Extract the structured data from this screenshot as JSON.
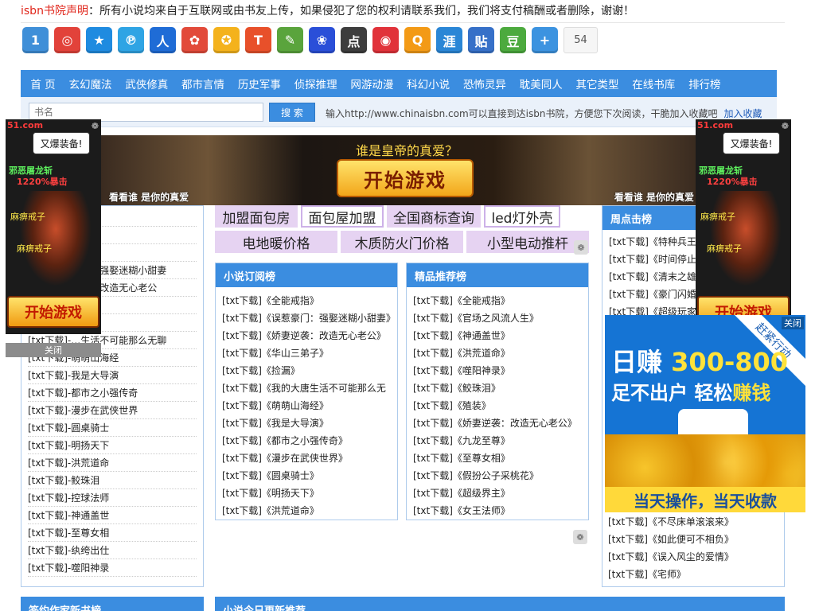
{
  "notice": {
    "label": "isbn书院声明",
    "text": "：所有小说均来自于互联网或由书友上传，如果侵犯了您的权利请联系我们，我们将支付稿酬或者删除，谢谢！"
  },
  "share": {
    "icons": [
      {
        "name": "qzone-icon",
        "glyph": "1",
        "color": "#3f8fd8"
      },
      {
        "name": "weibo-icon",
        "glyph": "◎",
        "color": "#e2423a"
      },
      {
        "name": "tencent-weibo-icon",
        "glyph": "★",
        "color": "#1f8be0"
      },
      {
        "name": "qq-friend-icon",
        "glyph": "℗",
        "color": "#2fa4e4"
      },
      {
        "name": "renren-icon",
        "glyph": "人",
        "color": "#1f6cd6"
      },
      {
        "name": "kaixin-icon",
        "glyph": "✿",
        "color": "#e24a3a"
      },
      {
        "name": "pengyou-icon",
        "glyph": "✪",
        "color": "#f4b21c"
      },
      {
        "name": "tieba-icon",
        "glyph": "T",
        "color": "#e8502a"
      },
      {
        "name": "douban-say-icon",
        "glyph": "✎",
        "color": "#5aa43c"
      },
      {
        "name": "baidu-icon",
        "glyph": "❀",
        "color": "#2a4fd8"
      },
      {
        "name": "dianping-icon",
        "glyph": "点",
        "color": "#3d3d3d"
      },
      {
        "name": "netease-icon",
        "glyph": "◉",
        "color": "#e1323a"
      },
      {
        "name": "qq-icon",
        "glyph": "Q",
        "color": "#f39a16"
      },
      {
        "name": "shengqian-icon",
        "glyph": "涯",
        "color": "#2a86d6"
      },
      {
        "name": "tieba-post-icon",
        "glyph": "贴",
        "color": "#3670c8"
      },
      {
        "name": "douban-icon",
        "glyph": "豆",
        "color": "#4caa3e"
      },
      {
        "name": "more-share-icon",
        "glyph": "+",
        "color": "#3c93e0"
      }
    ],
    "count": "54"
  },
  "nav": [
    "首 页",
    "玄幻魔法",
    "武侠修真",
    "都市言情",
    "历史军事",
    "侦探推理",
    "网游动漫",
    "科幻小说",
    "恐怖灵异",
    "耽美同人",
    "其它类型",
    "在线书库",
    "排行榜"
  ],
  "search": {
    "placeholder": "书名",
    "button": "搜 索",
    "hint": "输入http://www.chinaisbn.com可以直接到达isbn书院，方便您下次阅读，干脆加入收藏吧",
    "fav": "加入收藏"
  },
  "banner": {
    "title": "谁是皇帝的真爱？",
    "button": "开始游戏",
    "caption": "看看谁 是你的真爱"
  },
  "side_ad": {
    "brand": "51.com",
    "bubble": "又爆装备!",
    "slogan1": "邪恶屠龙斩",
    "slogan2": "1220%暴击",
    "tag": "麻痹戒子",
    "button": "开始游戏",
    "close": "关闭"
  },
  "keywords": {
    "row1": [
      "加盟面包房",
      "面包屋加盟",
      "全国商标查询",
      "led灯外壳"
    ],
    "row2": [
      "电地暖价格",
      "木质防火门价格",
      "小型电动推杆"
    ]
  },
  "left_list": {
    "items": [
      "",
      "",
      "[txt下载]-…爹",
      "[txt下载]-…门：强娶迷糊小甜妻",
      "[txt下载]-…袭：改造无心老公",
      "[txt下载]-…弟子",
      "",
      "[txt下载]-…生活不可能那么无聊",
      "[txt下载]-萌萌山海经",
      "[txt下载]-我是大导演",
      "[txt下载]-都市之小强传奇",
      "[txt下载]-漫步在武侠世界",
      "[txt下载]-圆桌骑士",
      "[txt下载]-明扬天下",
      "[txt下载]-洪荒道命",
      "[txt下载]-鲛珠泪",
      "[txt下载]-控球法师",
      "[txt下载]-神通盖世",
      "[txt下载]-至尊女相",
      "[txt下载]-纨绔出仕",
      "[txt下载]-噬阳神录"
    ]
  },
  "rank_a": {
    "title": "小说订阅榜",
    "items": [
      "[txt下载]《全能戒指》",
      "[txt下载]《误惹豪门：强娶迷糊小甜妻》",
      "[txt下载]《娇妻逆袭：改造无心老公》",
      "[txt下载]《华山三弟子》",
      "[txt下载]《捡漏》",
      "[txt下载]《我的大唐生活不可能那么无",
      "[txt下载]《萌萌山海经》",
      "[txt下载]《我是大导演》",
      "[txt下载]《都市之小强传奇》",
      "[txt下载]《漫步在武侠世界》",
      "[txt下载]《圆桌骑士》",
      "[txt下载]《明扬天下》",
      "[txt下载]《洪荒道命》"
    ]
  },
  "rank_b": {
    "title": "精品推荐榜",
    "items": [
      "[txt下载]《全能戒指》",
      "[txt下载]《官场之风流人生》",
      "[txt下载]《神通盖世》",
      "[txt下载]《洪荒道命》",
      "[txt下载]《噬阳神录》",
      "[txt下载]《鲛珠泪》",
      "[txt下载]《殖装》",
      "[txt下载]《娇妻逆袭：改造无心老公》",
      "[txt下载]《九龙至尊》",
      "[txt下载]《至尊女相》",
      "[txt下载]《假扮公子采桃花》",
      "[txt下载]《超级界主》",
      "[txt下载]《女王法师》"
    ]
  },
  "right_col": {
    "title": "周点击榜",
    "items": [
      "[txt下载]《特种兵王纟",
      "[txt下载]《时间停止器",
      "[txt下载]《清末之雄霸",
      "[txt下载]《豪门闪婚",
      "[txt下载]《超级玩家"
    ],
    "lower_items": [
      "[txt下载]《不尽床单滚滚来》",
      "[txt下载]《如此便可不相负》",
      "[txt下载]《误入风尘的爱情》",
      "[txt下载]《宅师》"
    ]
  },
  "float_ad": {
    "close": "关闭",
    "ribbon": "赶紧行动",
    "line1_a": "日赚",
    "line1_b": "300-800",
    "line2_a": "足不出户 轻松",
    "line2_b": "赚钱",
    "foot": "当天操作，当天收款"
  },
  "bottom": {
    "left_title": "签约作家新书榜",
    "right_title": "小说今日更新推荐"
  }
}
